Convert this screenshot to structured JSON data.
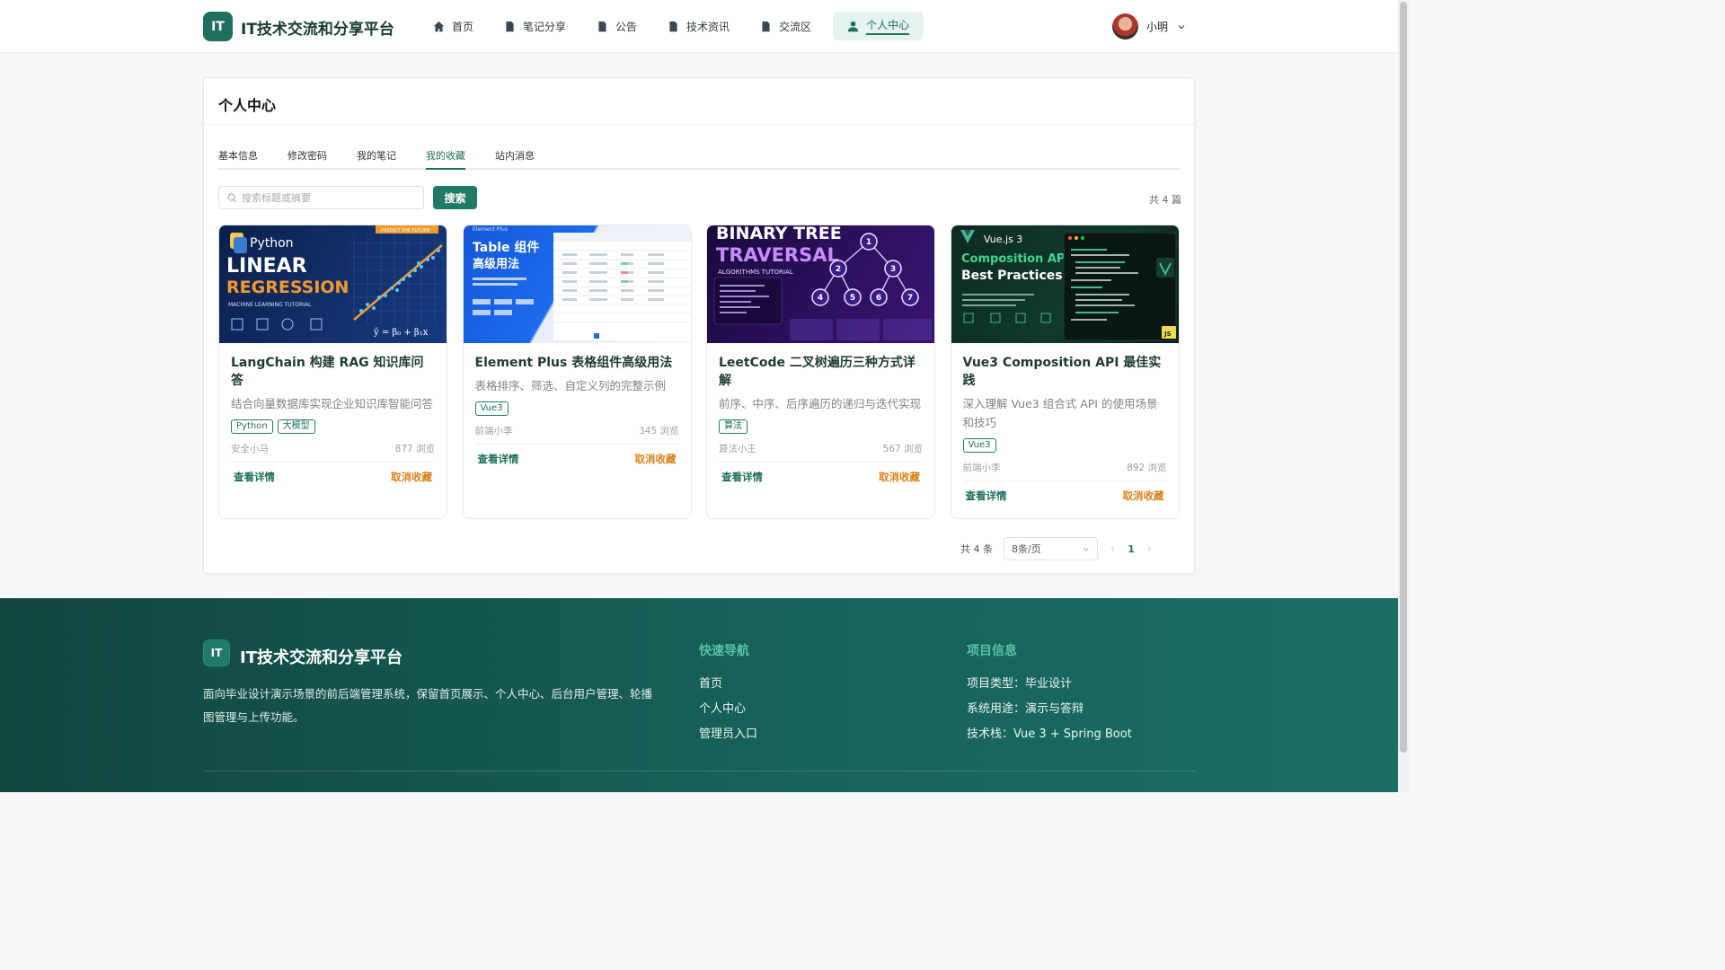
{
  "header": {
    "logo_badge": "IT",
    "title": "IT技术交流和分享平台",
    "nav": [
      {
        "label": "首页",
        "icon": "home-icon"
      },
      {
        "label": "笔记分享",
        "icon": "document-icon"
      },
      {
        "label": "公告",
        "icon": "document-icon"
      },
      {
        "label": "技术资讯",
        "icon": "document-icon"
      },
      {
        "label": "交流区",
        "icon": "document-icon"
      },
      {
        "label": "个人中心",
        "icon": "user-icon",
        "active": true
      }
    ],
    "user_name": "小明"
  },
  "panel": {
    "title": "个人中心",
    "tabs": [
      "基本信息",
      "修改密码",
      "我的笔记",
      "我的收藏",
      "站内消息"
    ],
    "active_tab": "我的收藏",
    "search_placeholder": "搜索标题或摘要",
    "search_button": "搜索",
    "total_top": "共 4 篇"
  },
  "cards": [
    {
      "title": "LangChain 构建 RAG 知识库问答",
      "desc": "结合向量数据库实现企业知识库智能问答",
      "tags": [
        "Python",
        "大模型"
      ],
      "author": "安全小马",
      "views": "877 浏览",
      "thumb": {
        "line1": "Python",
        "line2": "LINEAR",
        "line3": "REGRESSION",
        "line4": "MACHINE LEARNING TUTORIAL",
        "corner": "PREDICT THE FUTURE"
      }
    },
    {
      "title": "Element Plus 表格组件高级用法",
      "desc": "表格排序、筛选、自定义列的完整示例",
      "tags": [
        "Vue3"
      ],
      "author": "前端小李",
      "views": "345 浏览",
      "thumb": {
        "line1": "Element Plus",
        "line2": "Table 组件",
        "line3": "高级用法"
      }
    },
    {
      "title": "LeetCode 二叉树遍历三种方式详解",
      "desc": "前序、中序、后序遍历的递归与迭代实现",
      "tags": [
        "算法"
      ],
      "author": "算法小王",
      "views": "567 浏览",
      "thumb": {
        "line1": "BINARY TREE",
        "line2": "TRAVERSAL",
        "line3": "ALGORITHMS TUTORIAL",
        "nodes": [
          "1",
          "2",
          "3",
          "4",
          "5",
          "6",
          "7"
        ]
      }
    },
    {
      "title": "Vue3 Composition API 最佳实践",
      "desc": "深入理解 Vue3 组合式 API 的使用场景和技巧",
      "tags": [
        "Vue3"
      ],
      "author": "前端小李",
      "views": "892 浏览",
      "thumb": {
        "line1": "Vue.js 3",
        "line2": "Composition API",
        "line3": "Best Practices",
        "badge": "JS"
      }
    }
  ],
  "card_actions": {
    "view": "查看详情",
    "cancel": "取消收藏"
  },
  "pagination": {
    "total": "共 4 条",
    "page_size": "8条/页",
    "current_page": "1"
  },
  "footer": {
    "badge": "IT",
    "title": "IT技术交流和分享平台",
    "desc": "面向毕业设计演示场景的前后端管理系统，保留首页展示、个人中心、后台用户管理、轮播图管理与上传功能。",
    "quick_nav_title": "快速导航",
    "quick_nav": [
      "首页",
      "个人中心",
      "管理员入口"
    ],
    "project_title": "项目信息",
    "project_info": [
      "项目类型：毕业设计",
      "系统用途：演示与答辩",
      "技术栈：Vue 3 + Spring Boot"
    ]
  },
  "colors": {
    "primary": "#1f6f5f",
    "accent_orange": "#d9821c",
    "footer_bg": "#17615a"
  }
}
